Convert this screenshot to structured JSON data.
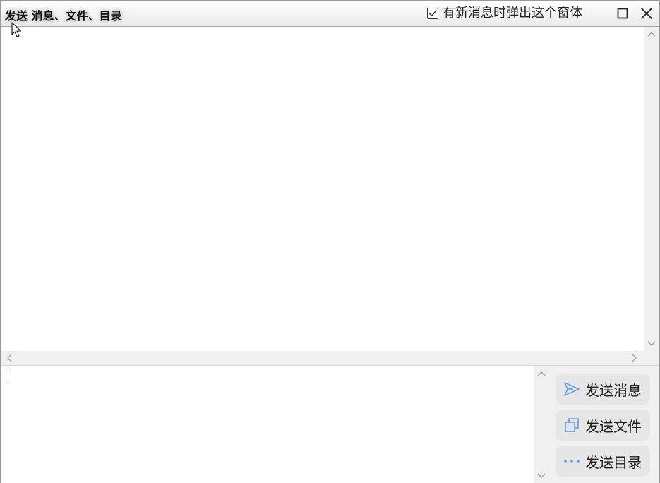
{
  "window": {
    "title": "发送 消息、文件、目录",
    "popup_option": {
      "label": "有新消息时弹出这个窗体",
      "checked": true
    },
    "controls": {
      "maximize_icon": "maximize-icon",
      "close_icon": "close-icon"
    }
  },
  "message_area": {
    "content": ""
  },
  "input_area": {
    "value": ""
  },
  "actions": [
    {
      "label": "发送消息",
      "icon": "send-icon"
    },
    {
      "label": "发送文件",
      "icon": "copy-file-icon"
    },
    {
      "label": "发送目录",
      "icon": "more-dots-icon"
    }
  ],
  "colors": {
    "accent": "#5a9fe6",
    "button_bg": "#e6e6e6",
    "panel_bg": "#f0f0f0"
  }
}
